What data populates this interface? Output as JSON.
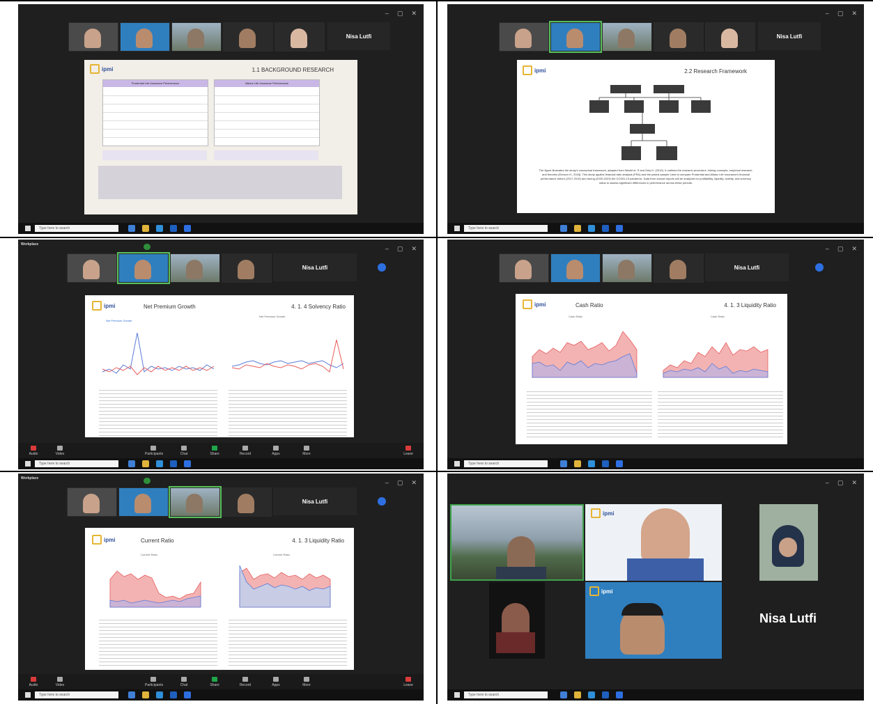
{
  "panel1": {
    "name_card": "Nisa Lutfi",
    "thumb_names": [
      "",
      "",
      "",
      "",
      ""
    ],
    "slide_brand": "ipmi",
    "slide_heading": "1.1 BACKGROUND RESEARCH",
    "table_left_title": "Prudential Life Insurance Performance",
    "table_right_title": "Allianz Life Insurance Performance"
  },
  "panel2": {
    "name_card": "Nisa Lutfi",
    "slide_brand": "ipmi",
    "slide_heading": "2.2 Research Framework",
    "paragraph": "The figure illustrates the study's conceptual framework, adapted from Wadid et. S and Dely H. (2019). It outlines the research procedure, linking concepts, empirical research, and theories (Ericson H., 2018). This study applies financial ratio analysis (FRA) and the paired-sample t-test to compare Prudential and Allianz Life Insurance's financial performance before (2017-2019) and during (2020-2023) the COVID-19 pandemic. Data from annual reports will be analyzed for profitability, liquidity, activity, and solvency ratios to assess significant differences in performance across these periods."
  },
  "panel3": {
    "app_label": "Workplace",
    "name_card": "Nisa Lutfi",
    "slide_brand": "ipmi",
    "slide_title": "Net Premium Growth",
    "slide_heading": "4. 1. 4 Solvency Ratio",
    "chart_left_title": "Net Premium Growth",
    "chart_right_title": "Net Premium Growth"
  },
  "panel4": {
    "name_card": "Nisa Lutfi",
    "slide_brand": "ipmi",
    "slide_title": "Cash Ratio",
    "slide_heading": "4. 1. 3 Liquidity Ratio",
    "chart_left_title": "Cash Ratio",
    "chart_right_title": "Cash Ratio"
  },
  "panel5": {
    "app_label": "Workplace",
    "name_card": "Nisa Lutfi",
    "slide_brand": "ipmi",
    "slide_title": "Current Ratio",
    "slide_heading": "4. 1. 3 Liquidity Ratio",
    "chart_left_title": "Current Ratio",
    "chart_right_title": "Current Ratio"
  },
  "panel6": {
    "big_name": "Nisa Lutfi",
    "brand": "ipmi"
  },
  "taskbar": {
    "search_placeholder": "Type here to search"
  },
  "zoom_toolbar": {
    "buttons": [
      "Audio",
      "Video",
      "Participants",
      "Chat",
      "Share",
      "Record",
      "Apps",
      "More",
      "Leave"
    ]
  },
  "colors": {
    "zoom_bg": "#1f1f1f",
    "slide_accent_purple": "#c9b7e6",
    "chart_red": "#e85a5a",
    "chart_blue": "#5b7bd6",
    "brand_blue": "#2f4f9a",
    "brand_gold": "#e6b534"
  }
}
